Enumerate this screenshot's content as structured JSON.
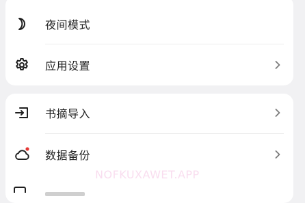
{
  "settings": {
    "group1": [
      {
        "label": "夜间模式",
        "icon": "moon-icon",
        "chevron": false
      },
      {
        "label": "应用设置",
        "icon": "gear-icon",
        "chevron": true
      }
    ],
    "group2": [
      {
        "label": "书摘导入",
        "icon": "import-icon",
        "chevron": true
      },
      {
        "label": "数据备份",
        "icon": "cloud-icon",
        "chevron": true,
        "badge_color": "#e53935"
      }
    ]
  },
  "watermark": "NOFKUXAWET.APP",
  "colors": {
    "background": "#f1f1f3",
    "card": "#ffffff",
    "text": "#1f1f1f",
    "icon": "#1f1f1f",
    "chevron": "#7a7a7a",
    "badge": "#e53935"
  }
}
